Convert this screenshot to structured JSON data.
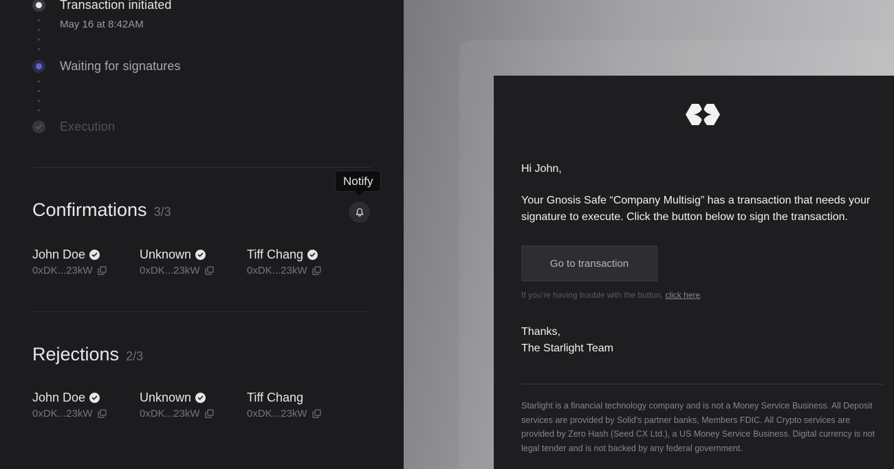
{
  "timeline": {
    "steps": [
      {
        "label": "Transaction initiated",
        "sub": "May 16 at 8:42AM",
        "state": "done"
      },
      {
        "label": "Waiting for signatures",
        "sub": "",
        "state": "active"
      },
      {
        "label": "Execution",
        "sub": "",
        "state": "pending"
      }
    ]
  },
  "tooltip": {
    "text": "Notify"
  },
  "confirmations": {
    "title": "Confirmations",
    "count": "3/3",
    "signers": [
      {
        "name": "John Doe",
        "address": "0xDK...23kW",
        "verified": true
      },
      {
        "name": "Unknown",
        "address": "0xDK...23kW",
        "verified": true
      },
      {
        "name": "Tiff Chang",
        "address": "0xDK...23kW",
        "verified": true
      }
    ]
  },
  "rejections": {
    "title": "Rejections",
    "count": "2/3",
    "signers": [
      {
        "name": "John Doe",
        "address": "0xDK...23kW",
        "verified": true
      },
      {
        "name": "Unknown",
        "address": "0xDK...23kW",
        "verified": true
      },
      {
        "name": "Tiff Chang",
        "address": "0xDK...23kW",
        "verified": false
      }
    ]
  },
  "email": {
    "greeting": "Hi John,",
    "body": "Your Gnosis Safe “Company Multisig” has a transaction that needs your signature to execute. Click the button below to sign the transaction.",
    "button_label": "Go to transaction",
    "trouble_prefix": "If you’re having trouble with the button, ",
    "trouble_link": "click here",
    "trouble_suffix": ".",
    "signoff": "Thanks,",
    "team": "The Starlight Team",
    "disclaimer": "Starlight is a financial technology company and is not a Money Service Business. All Deposit services are provided by Solid's partner banks, Members FDIC. All Crypto services are provided by Zero Hash (Seed CX Ltd.), a US Money Service Business. Digital currency is not legal tender and is not backed by any federal government."
  },
  "colors": {
    "panel_bg": "#1c1c1f",
    "accent": "#5f63d6",
    "email_bg": "#1e1e20"
  },
  "icons": {
    "notify": "bell-icon",
    "verified": "check-circle-icon",
    "copy": "copy-icon",
    "logo": "starlight-logo-icon"
  }
}
